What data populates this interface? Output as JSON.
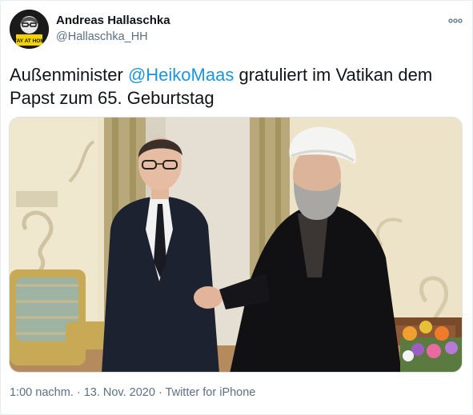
{
  "author": {
    "name": "Andreas Hallaschka",
    "handle": "@Hallaschka_HH",
    "avatar_text": "STAY AT HOME"
  },
  "tweet": {
    "text_before": "Außenminister ",
    "mention": "@HeikoMaas",
    "text_after": " gratuliert im Vatikan dem Papst zum 65. Geburtstag"
  },
  "meta": {
    "time": "1:00 nachm.",
    "separator1": " · ",
    "date": "13. Nov. 2020",
    "separator2": " · ",
    "source": "Twitter for iPhone"
  },
  "icons": {
    "more": "more-horizontal-icon"
  },
  "colors": {
    "link": "#1b95e0",
    "secondary": "#5b7083",
    "text": "#0f1419"
  }
}
